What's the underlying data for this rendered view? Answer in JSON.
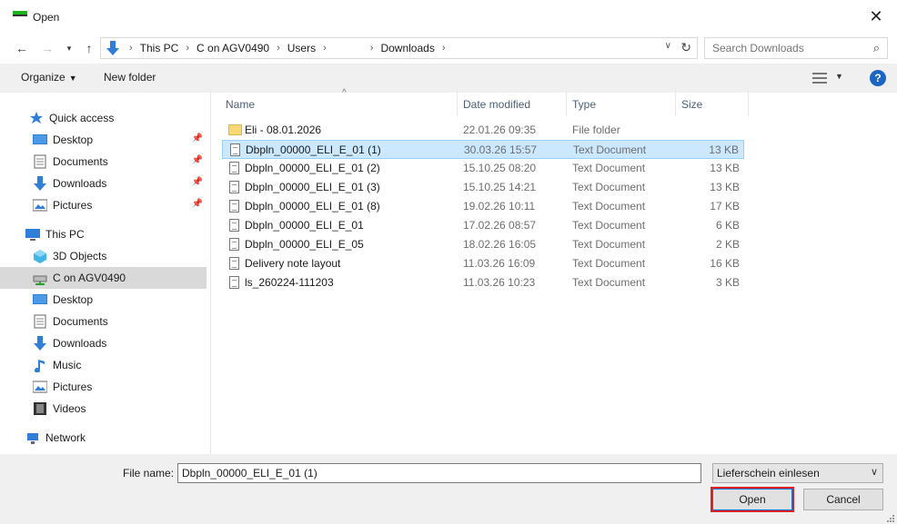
{
  "window": {
    "title": "Open"
  },
  "address": {
    "crumbs": [
      "This PC",
      "C on AGV0490",
      "Users",
      "",
      "Downloads"
    ]
  },
  "search": {
    "placeholder": "Search Downloads"
  },
  "toolbar": {
    "organize_label": "Organize",
    "new_folder_label": "New folder"
  },
  "sidebar": {
    "items": [
      {
        "label": "Quick access",
        "icon": "star-icon"
      },
      {
        "label": "Desktop",
        "icon": "desktop-icon",
        "pinned": true
      },
      {
        "label": "Documents",
        "icon": "documents-icon",
        "pinned": true
      },
      {
        "label": "Downloads",
        "icon": "downloads-icon",
        "pinned": true
      },
      {
        "label": "Pictures",
        "icon": "pictures-icon",
        "pinned": true
      },
      {
        "label": "This PC",
        "icon": "pc-icon"
      },
      {
        "label": "3D Objects",
        "icon": "3d-objects-icon"
      },
      {
        "label": "C on AGV0490",
        "icon": "network-drive-icon",
        "selected": true
      },
      {
        "label": "Desktop",
        "icon": "desktop-icon"
      },
      {
        "label": "Documents",
        "icon": "documents-icon"
      },
      {
        "label": "Downloads",
        "icon": "downloads-icon"
      },
      {
        "label": "Music",
        "icon": "music-icon"
      },
      {
        "label": "Pictures",
        "icon": "pictures-icon"
      },
      {
        "label": "Videos",
        "icon": "videos-icon"
      },
      {
        "label": "Network",
        "icon": "network-icon"
      }
    ]
  },
  "columns": {
    "name": "Name",
    "date": "Date modified",
    "type": "Type",
    "size": "Size"
  },
  "files": [
    {
      "name": "Eli -              08.01.2026",
      "date": "22.01.26 09:35",
      "type": "File folder",
      "size": "",
      "kind": "folder"
    },
    {
      "name": "Dbpln_00000_ELI_E_01 (1)",
      "date": "30.03.26 15:57",
      "type": "Text Document",
      "size": "13 KB",
      "kind": "doc",
      "selected": true
    },
    {
      "name": "Dbpln_00000_ELI_E_01 (2)",
      "date": "15.10.25 08:20",
      "type": "Text Document",
      "size": "13 KB",
      "kind": "doc"
    },
    {
      "name": "Dbpln_00000_ELI_E_01 (3)",
      "date": "15.10.25 14:21",
      "type": "Text Document",
      "size": "13 KB",
      "kind": "doc"
    },
    {
      "name": "Dbpln_00000_ELI_E_01 (8)",
      "date": "19.02.26 10:11",
      "type": "Text Document",
      "size": "17 KB",
      "kind": "doc"
    },
    {
      "name": "Dbpln_00000_ELI_E_01",
      "date": "17.02.26 08:57",
      "type": "Text Document",
      "size": "6 KB",
      "kind": "doc"
    },
    {
      "name": "Dbpln_00000_ELI_E_05",
      "date": "18.02.26 16:05",
      "type": "Text Document",
      "size": "2 KB",
      "kind": "doc"
    },
    {
      "name": "Delivery note layout",
      "date": "11.03.26 16:09",
      "type": "Text Document",
      "size": "16 KB",
      "kind": "doc"
    },
    {
      "name": "ls_260224-111203",
      "date": "11.03.26 10:23",
      "type": "Text Document",
      "size": "3 KB",
      "kind": "doc"
    }
  ],
  "footer": {
    "filename_label": "File name:",
    "filename_value": "Dbpln_00000_ELI_E_01 (1)",
    "filter_value": "Lieferschein einlesen",
    "open_label": "Open",
    "cancel_label": "Cancel"
  },
  "colors": {
    "accent": "#0078d7",
    "selection": "#cce8ff",
    "highlight_border": "#e02020"
  }
}
